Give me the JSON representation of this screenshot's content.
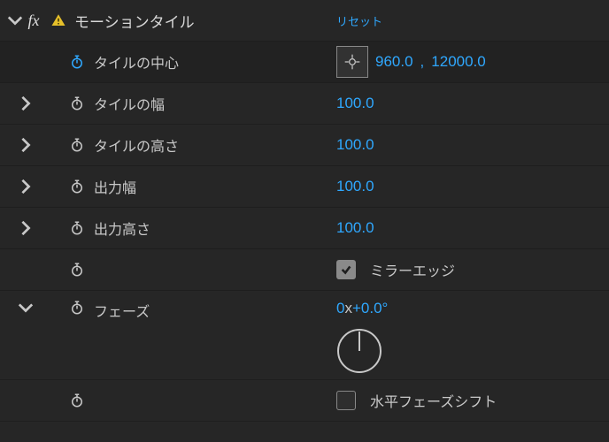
{
  "effect": {
    "name": "モーションタイル",
    "reset_label": "リセット"
  },
  "props": {
    "tile_center": {
      "label": "タイルの中心",
      "x": "960.0",
      "y": "12000.0"
    },
    "tile_width": {
      "label": "タイルの幅",
      "value": "100.0"
    },
    "tile_height": {
      "label": "タイルの高さ",
      "value": "100.0"
    },
    "output_width": {
      "label": "出力幅",
      "value": "100.0"
    },
    "output_height": {
      "label": "出力高さ",
      "value": "100.0"
    },
    "mirror_edges": {
      "label": "ミラーエッジ",
      "checked": true
    },
    "phase": {
      "label": "フェーズ",
      "revolutions": "0",
      "sep": "x",
      "degrees": "+0.0°"
    },
    "horizontal_phase_shift": {
      "label": "水平フェーズシフト",
      "checked": false
    }
  }
}
